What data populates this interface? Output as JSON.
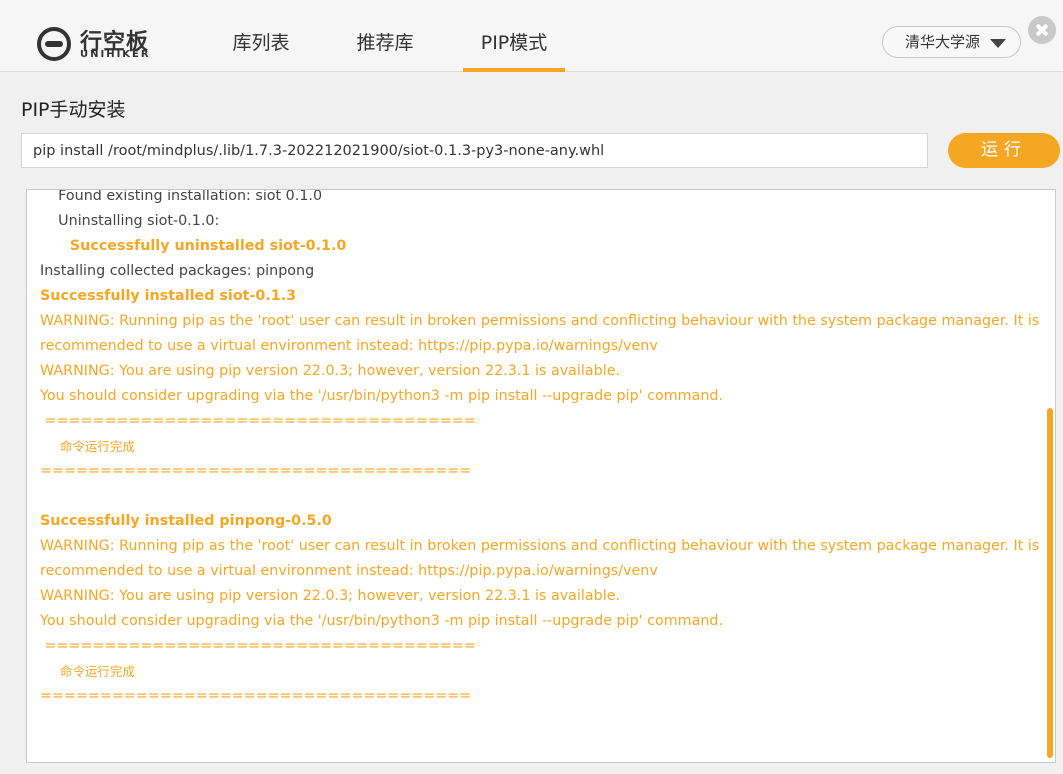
{
  "header": {
    "logo_cn": "行空板",
    "logo_en": "UNIHIKER",
    "tabs": [
      {
        "label": "库列表"
      },
      {
        "label": "推荐库"
      },
      {
        "label": "PIP模式"
      }
    ],
    "active_tab": "PIP模式",
    "source_select": "清华大学源"
  },
  "pip": {
    "title": "PIP手动安装",
    "command": "pip install /root/mindplus/.lib/1.7.3-202212021900/siot-0.1.3-py3-none-any.whl",
    "run_label": "运行"
  },
  "console": {
    "lines": [
      "    Found existing installation: siot 0.1.0",
      "    Uninstalling siot-0.1.0:",
      "      Successfully uninstalled siot-0.1.0",
      "Installing collected packages: pinpong",
      "Successfully installed siot-0.1.3",
      "WARNING: Running pip as the 'root' user can result in broken permissions and conflicting behaviour with the system package manager. It is",
      "recommended to use a virtual environment instead: https://pip.pypa.io/warnings/venv",
      "WARNING: You are using pip version 22.0.3; however, version 22.3.1 is available.",
      "You should consider upgrading via the '/usr/bin/python3 -m pip install --upgrade pip' command.",
      " ====================================",
      "     命令运行完成",
      "====================================",
      "",
      "Successfully installed pinpong-0.5.0",
      "WARNING: Running pip as the 'root' user can result in broken permissions and conflicting behaviour with the system package manager. It is",
      "recommended to use a virtual environment instead: https://pip.pypa.io/warnings/venv",
      "WARNING: You are using pip version 22.0.3; however, version 22.3.1 is available.",
      "You should consider upgrading via the '/usr/bin/python3 -m pip install --upgrade pip' command.",
      " ====================================",
      "     命令运行完成",
      "===================================="
    ]
  },
  "colors": {
    "accent": "#f5a623",
    "text": "#333333"
  }
}
